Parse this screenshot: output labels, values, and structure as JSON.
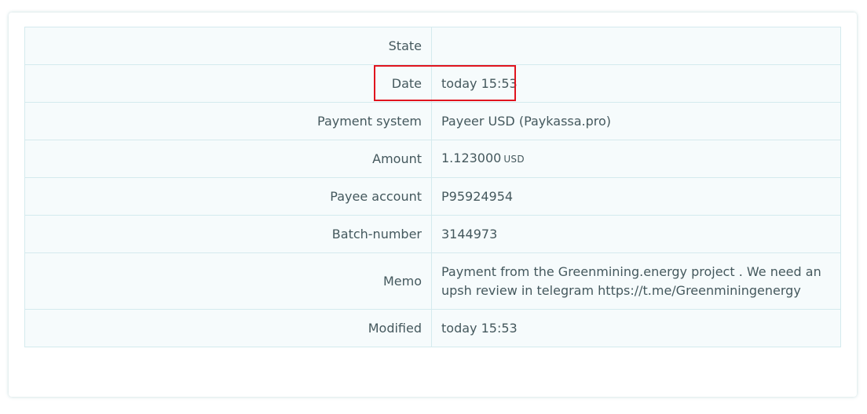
{
  "rows": [
    {
      "label": "State",
      "value": ""
    },
    {
      "label": "Date",
      "value": "today 15:53"
    },
    {
      "label": "Payment system",
      "value": "Payeer USD (Paykassa.pro)"
    },
    {
      "label": "Amount",
      "value": "1.123000",
      "unit": "USD"
    },
    {
      "label": "Payee account",
      "value": "P95924954"
    },
    {
      "label": "Batch-number",
      "value": "3144973"
    },
    {
      "label": "Memo",
      "value": "Payment from the Greenmining.energy project . We need an upsh review in telegram https://t.me/Greenminingenergy"
    },
    {
      "label": "Modified",
      "value": "today 15:53"
    }
  ],
  "colors": {
    "text": "#44585d",
    "border": "#d4eaee",
    "row_bg": "#f6fbfc",
    "highlight": "#e0141e"
  }
}
